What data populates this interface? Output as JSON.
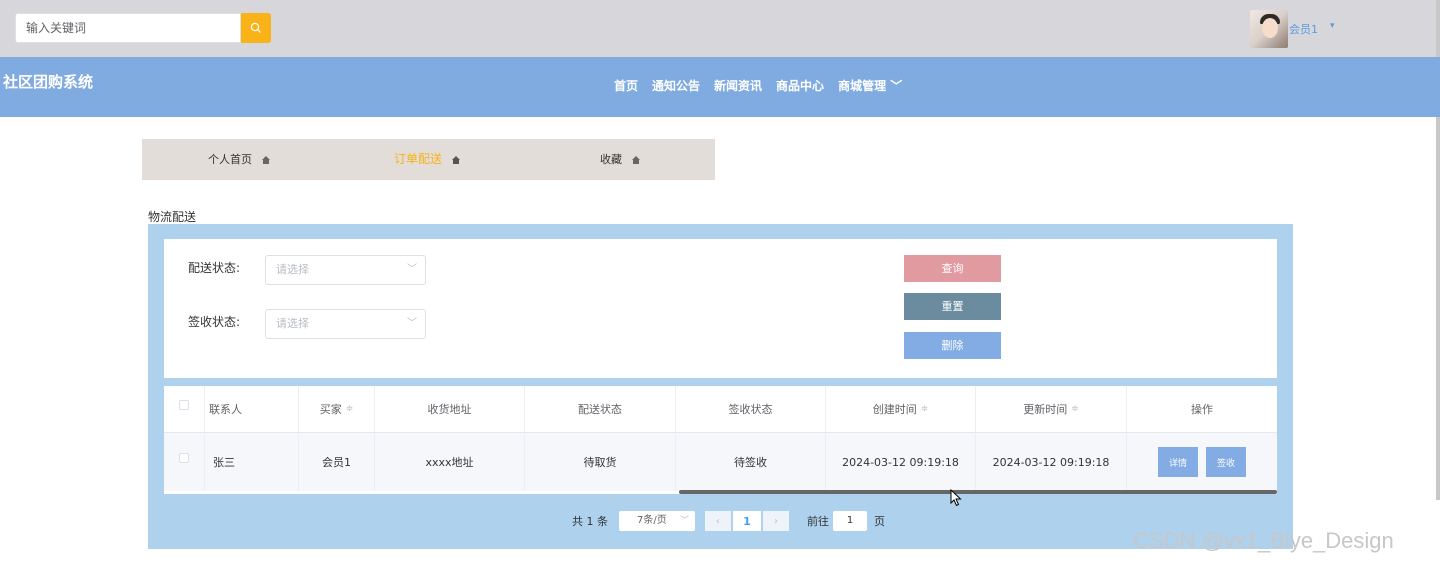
{
  "header": {
    "search_placeholder": "输入关键词",
    "user_name": "会员1",
    "user_caret": "▾"
  },
  "nav": {
    "brand": "社区团购系统",
    "items": [
      {
        "label": "首页"
      },
      {
        "label": "通知公告"
      },
      {
        "label": "新闻资讯"
      },
      {
        "label": "商品中心"
      },
      {
        "label": "商城管理 ﹀"
      }
    ]
  },
  "tabs": [
    {
      "label": "个人首页"
    },
    {
      "label": "订单配送"
    },
    {
      "label": "收藏"
    }
  ],
  "section_title": "物流配送",
  "filters": {
    "delivery_status_label": "配送状态:",
    "sign_status_label": "签收状态:",
    "select_placeholder": "请选择",
    "query_label": "查询",
    "reset_label": "重置",
    "delete_label": "删除"
  },
  "table": {
    "columns": [
      "联系人",
      "买家",
      "收货地址",
      "配送状态",
      "签收状态",
      "创建时间",
      "更新时间",
      "操作"
    ],
    "rows": [
      {
        "contact": "张三",
        "buyer": "会员1",
        "address": "xxxx地址",
        "delivery_status": "待取货",
        "sign_status": "待签收",
        "created": "2024-03-12 09:19:18",
        "updated": "2024-03-12 09:19:18",
        "detail_label": "详情",
        "sign_label": "签收"
      }
    ]
  },
  "pagination": {
    "total": "共 1 条",
    "page_size": "7条/页",
    "current_page": "1",
    "goto_label": "前往",
    "goto_value": "1",
    "page_unit": "页"
  },
  "watermark": "CSDN @vx1_Biye_Design",
  "colors": {
    "topbar": "#d7d6da",
    "navbar": "#80abe0",
    "accent": "#f9b218",
    "panel": "#aed1ee",
    "query_button": "#e29aa1",
    "reset_button": "#6a8c9e",
    "delete_button": "#82ace3"
  }
}
